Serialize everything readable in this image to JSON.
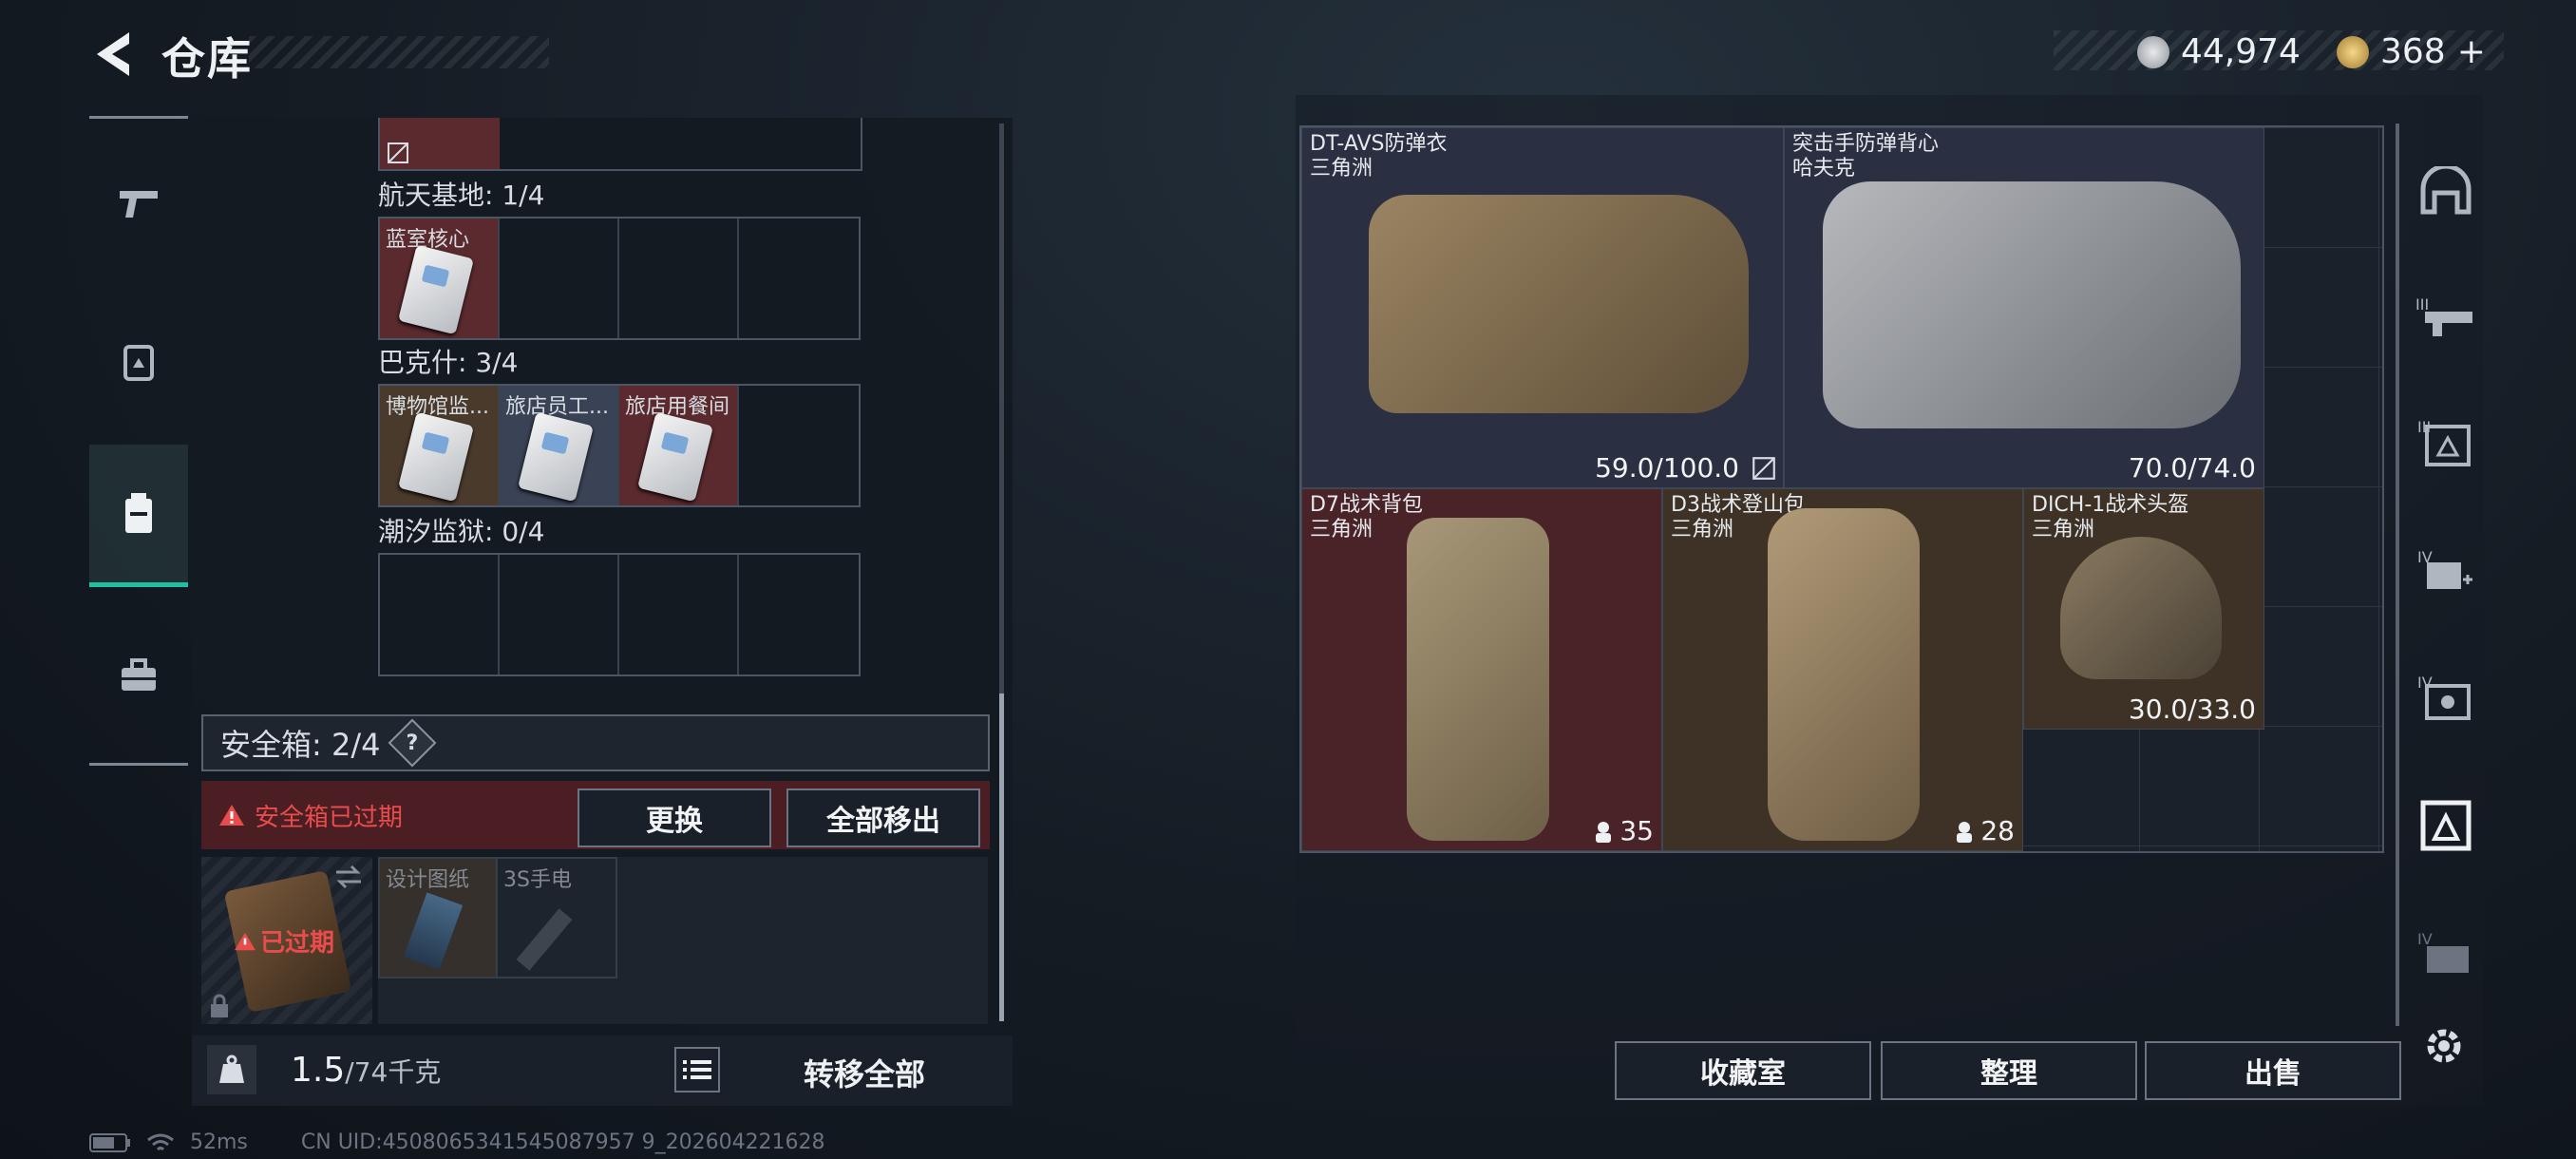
{
  "header": {
    "title": "仓库"
  },
  "currency": {
    "silver": "44,974",
    "gold": "368",
    "gold_plus": "+"
  },
  "left_panel": {
    "sections": [
      {
        "label": "航天基地: 1/4",
        "cells": [
          {
            "name": "蓝室核心",
            "color": "red"
          },
          null,
          null,
          null
        ]
      },
      {
        "label": "巴克什: 3/4",
        "cells": [
          {
            "name": "博物馆监...",
            "color": "brown"
          },
          {
            "name": "旅店员工...",
            "color": "blue"
          },
          {
            "name": "旅店用餐间",
            "color": "red"
          },
          null
        ]
      },
      {
        "label": "潮汐监狱: 0/4",
        "cells": [
          null,
          null,
          null,
          null
        ]
      }
    ],
    "safe_box": {
      "label": "安全箱: 2/4",
      "help": "?",
      "expired_warning": "安全箱已过期",
      "replace_button": "更换",
      "remove_all_button": "全部移出",
      "expired_tag": "已过期",
      "items": [
        {
          "name": "设计图纸"
        },
        {
          "name": "3S手电"
        }
      ]
    },
    "weight": {
      "current": "1.5",
      "max": "/74千克",
      "transfer_all": "转移全部"
    }
  },
  "right_panel": {
    "items": [
      {
        "name": "DT-AVS防弹衣",
        "source": "三角洲",
        "value": "59.0/100.0"
      },
      {
        "name": "突击手防弹背心",
        "source": "哈夫克",
        "value": "70.0/74.0"
      },
      {
        "name": "D7战术背包",
        "source": "三角洲",
        "value": "35"
      },
      {
        "name": "D3战术登山包",
        "source": "三角洲",
        "value": "28"
      },
      {
        "name": "DICH-1战术头盔",
        "source": "三角洲",
        "value": "30.0/33.0"
      }
    ],
    "buttons": {
      "collection": "收藏室",
      "sort": "整理",
      "sell": "出售"
    }
  },
  "status": {
    "ping": "52ms",
    "uid": "CN UID:4508065341545087957 9_202604221628"
  },
  "colors": {
    "accent": "#1fc0a0",
    "warning": "#e84c4c",
    "red_cell": "#5a2a2e",
    "brown_cell": "#4a3a2c"
  }
}
